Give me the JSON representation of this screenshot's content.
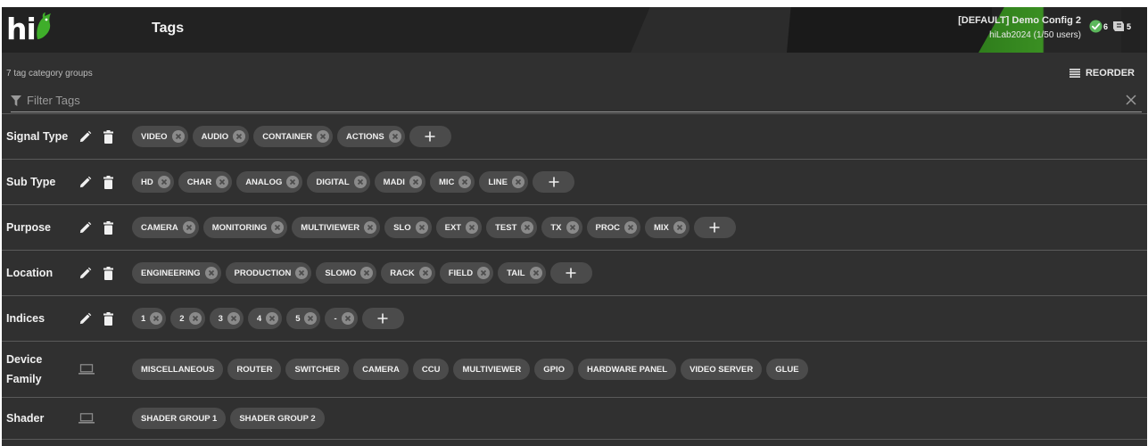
{
  "header": {
    "logo_text": "hi",
    "page_title": "Tags",
    "config_name": "[DEFAULT] Demo Config 2",
    "config_sub": "hiLab2024 (1/50 users)",
    "status": [
      {
        "icon": "check-circle-icon",
        "count": "6",
        "color": "#5cb85c"
      },
      {
        "icon": "alert-badge-icon",
        "count": "5",
        "color": "#d0d0d0"
      }
    ]
  },
  "toolbar": {
    "group_count": "7 tag category groups",
    "reorder_label": "REORDER"
  },
  "filter": {
    "placeholder": "Filter Tags",
    "value": ""
  },
  "rows": [
    {
      "label": "Signal Type",
      "editable": true,
      "tags": [
        "VIDEO",
        "AUDIO",
        "CONTAINER",
        "ACTIONS"
      ]
    },
    {
      "label": "Sub Type",
      "editable": true,
      "tags": [
        "HD",
        "CHAR",
        "ANALOG",
        "DIGITAL",
        "MADI",
        "MIC",
        "LINE"
      ]
    },
    {
      "label": "Purpose",
      "editable": true,
      "tags": [
        "CAMERA",
        "MONITORING",
        "MULTIVIEWER",
        "SLO",
        "EXT",
        "TEST",
        "TX",
        "PROC",
        "MIX"
      ]
    },
    {
      "label": "Location",
      "editable": true,
      "tags": [
        "ENGINEERING",
        "PRODUCTION",
        "SLOMO",
        "RACK",
        "FIELD",
        "TAIL"
      ]
    },
    {
      "label": "Indices",
      "editable": true,
      "tags": [
        "1",
        "2",
        "3",
        "4",
        "5",
        "-"
      ]
    },
    {
      "label": "Device Family",
      "editable": false,
      "tags": [
        "MISCELLANEOUS",
        "ROUTER",
        "SWITCHER",
        "CAMERA",
        "CCU",
        "MULTIVIEWER",
        "GPIO",
        "HARDWARE PANEL",
        "VIDEO SERVER",
        "GLUE"
      ]
    },
    {
      "label": "Shader",
      "editable": false,
      "tags": [
        "SHADER GROUP 1",
        "SHADER GROUP 2"
      ]
    }
  ],
  "colors": {
    "background": "#303030",
    "header": "#222222",
    "chip": "#4b4b4b",
    "accent_green": "#3a8f22"
  }
}
